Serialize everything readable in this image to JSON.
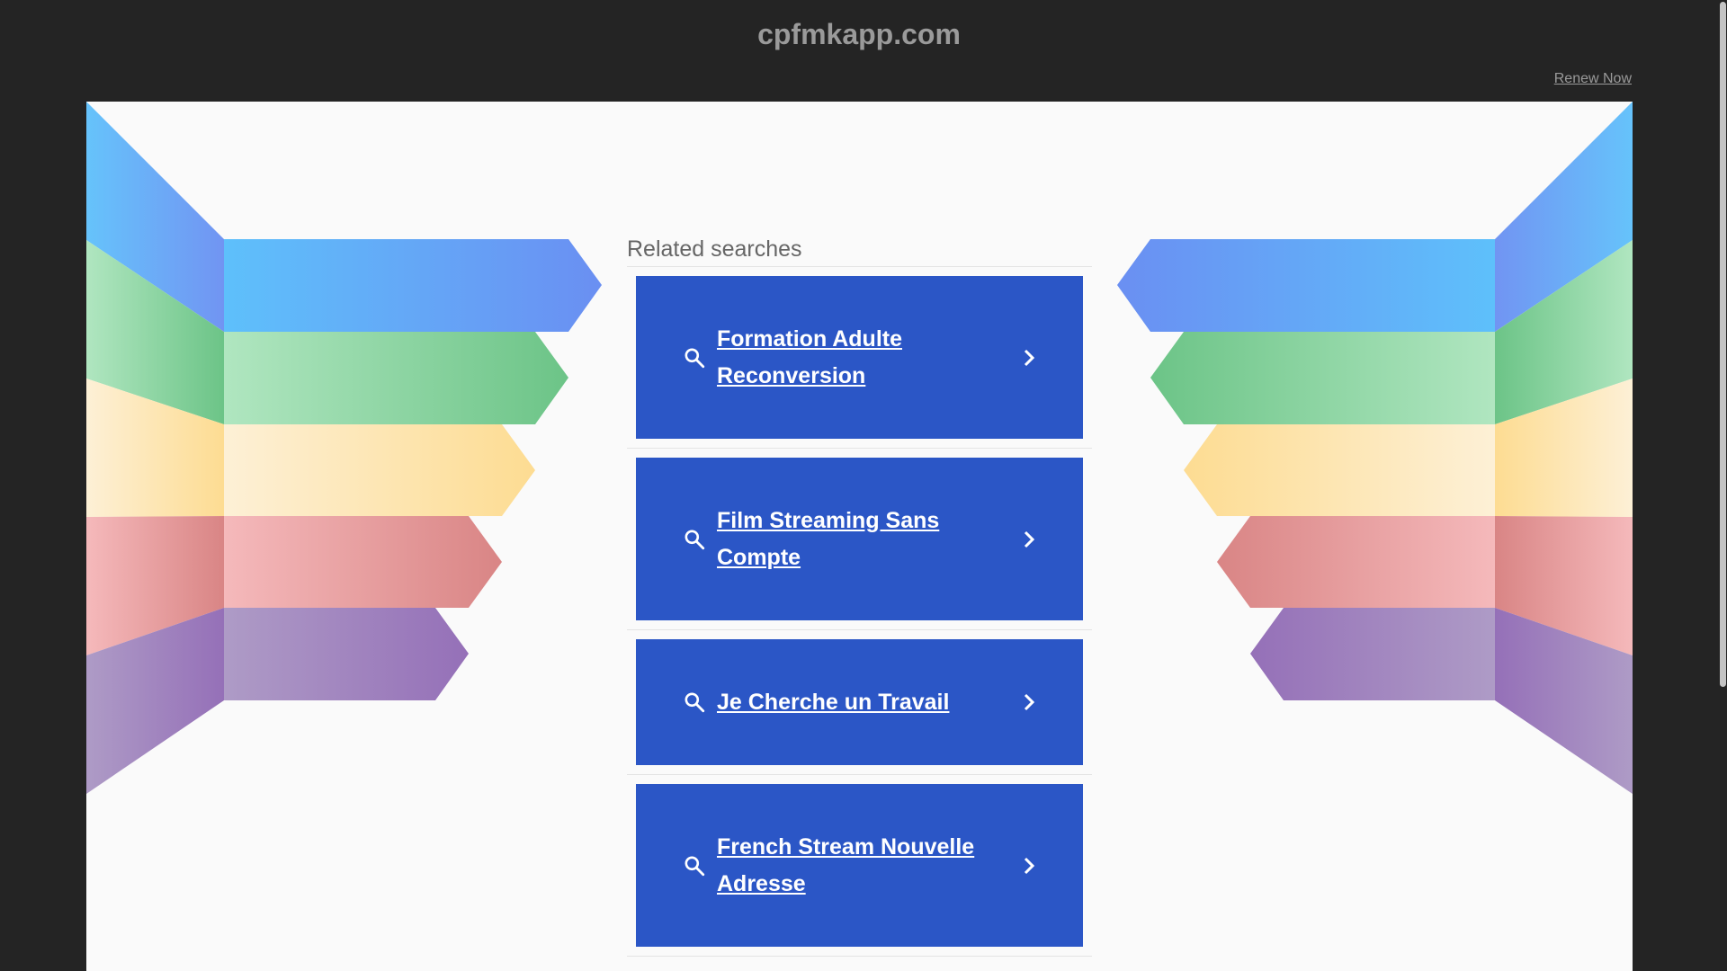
{
  "header": {
    "domain": "cpfmkapp.com",
    "renew_label": "Renew Now"
  },
  "related": {
    "heading": "Related searches",
    "items": [
      {
        "label": "Formation Adulte Reconversion"
      },
      {
        "label": "Film Streaming Sans Compte"
      },
      {
        "label": "Je Cherche un Travail"
      },
      {
        "label": "French Stream Nouvelle Adresse"
      }
    ]
  },
  "colors": {
    "background": "#242424",
    "content_background": "#fafafa",
    "result_button": "#2b56c6",
    "banner_blue": "#5aa9f5",
    "banner_green": "#7ccd8f",
    "banner_yellow": "#fde3a2",
    "banner_red": "#e39a9c",
    "banner_purple": "#a08cc4"
  },
  "icons": {
    "result_leading": "search-icon",
    "result_trailing": "chevron-right-icon"
  }
}
